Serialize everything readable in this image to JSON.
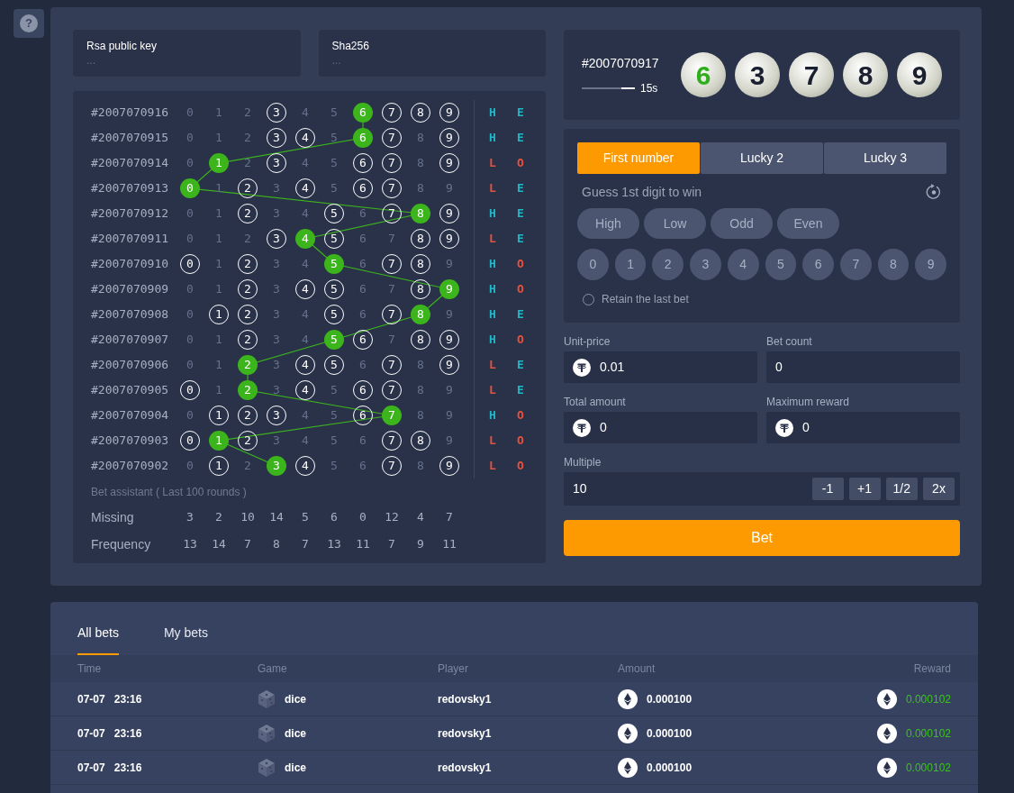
{
  "help_button": {
    "label": "?"
  },
  "keys": [
    {
      "label": "Rsa public key",
      "value": "..."
    },
    {
      "label": "Sha256",
      "value": "..."
    }
  ],
  "history": {
    "rows": [
      {
        "round": "#2007070916",
        "cells": [
          {
            "label": "0",
            "kind": "dim"
          },
          {
            "label": "1",
            "kind": "dim"
          },
          {
            "label": "2",
            "kind": "dim"
          },
          {
            "label": "3",
            "kind": "ring"
          },
          {
            "label": "4",
            "kind": "dim"
          },
          {
            "label": "5",
            "kind": "dim"
          },
          {
            "label": "6",
            "kind": "hit"
          },
          {
            "label": "7",
            "kind": "ring"
          },
          {
            "label": "8",
            "kind": "ring"
          },
          {
            "label": "9",
            "kind": "ring"
          }
        ],
        "size": {
          "label": "H",
          "color": "#1fb8c6"
        },
        "parity": {
          "label": "E",
          "color": "#1fb8c6"
        }
      },
      {
        "round": "#2007070915",
        "cells": [
          {
            "label": "0",
            "kind": "dim"
          },
          {
            "label": "1",
            "kind": "dim"
          },
          {
            "label": "2",
            "kind": "dim"
          },
          {
            "label": "3",
            "kind": "ring"
          },
          {
            "label": "4",
            "kind": "ring"
          },
          {
            "label": "5",
            "kind": "dim"
          },
          {
            "label": "6",
            "kind": "hit"
          },
          {
            "label": "7",
            "kind": "ring"
          },
          {
            "label": "8",
            "kind": "dim"
          },
          {
            "label": "9",
            "kind": "ring"
          }
        ],
        "size": {
          "label": "H",
          "color": "#1fb8c6"
        },
        "parity": {
          "label": "E",
          "color": "#1fb8c6"
        }
      },
      {
        "round": "#2007070914",
        "cells": [
          {
            "label": "0",
            "kind": "dim"
          },
          {
            "label": "1",
            "kind": "hit"
          },
          {
            "label": "2",
            "kind": "dim"
          },
          {
            "label": "3",
            "kind": "ring"
          },
          {
            "label": "4",
            "kind": "dim"
          },
          {
            "label": "5",
            "kind": "dim"
          },
          {
            "label": "6",
            "kind": "ring"
          },
          {
            "label": "7",
            "kind": "ring"
          },
          {
            "label": "8",
            "kind": "dim"
          },
          {
            "label": "9",
            "kind": "ring"
          }
        ],
        "size": {
          "label": "L",
          "color": "#e5523c"
        },
        "parity": {
          "label": "O",
          "color": "#e5523c"
        }
      },
      {
        "round": "#2007070913",
        "cells": [
          {
            "label": "0",
            "kind": "hit"
          },
          {
            "label": "1",
            "kind": "dim"
          },
          {
            "label": "2",
            "kind": "ring"
          },
          {
            "label": "3",
            "kind": "dim"
          },
          {
            "label": "4",
            "kind": "ring"
          },
          {
            "label": "5",
            "kind": "dim"
          },
          {
            "label": "6",
            "kind": "ring"
          },
          {
            "label": "7",
            "kind": "ring"
          },
          {
            "label": "8",
            "kind": "dim"
          },
          {
            "label": "9",
            "kind": "dim"
          }
        ],
        "size": {
          "label": "L",
          "color": "#e5523c"
        },
        "parity": {
          "label": "E",
          "color": "#1fb8c6"
        }
      },
      {
        "round": "#2007070912",
        "cells": [
          {
            "label": "0",
            "kind": "dim"
          },
          {
            "label": "1",
            "kind": "dim"
          },
          {
            "label": "2",
            "kind": "ring"
          },
          {
            "label": "3",
            "kind": "dim"
          },
          {
            "label": "4",
            "kind": "dim"
          },
          {
            "label": "5",
            "kind": "ring"
          },
          {
            "label": "6",
            "kind": "dim"
          },
          {
            "label": "7",
            "kind": "ring"
          },
          {
            "label": "8",
            "kind": "hit"
          },
          {
            "label": "9",
            "kind": "ring"
          }
        ],
        "size": {
          "label": "H",
          "color": "#1fb8c6"
        },
        "parity": {
          "label": "E",
          "color": "#1fb8c6"
        }
      },
      {
        "round": "#2007070911",
        "cells": [
          {
            "label": "0",
            "kind": "dim"
          },
          {
            "label": "1",
            "kind": "dim"
          },
          {
            "label": "2",
            "kind": "dim"
          },
          {
            "label": "3",
            "kind": "ring"
          },
          {
            "label": "4",
            "kind": "hit"
          },
          {
            "label": "5",
            "kind": "ring"
          },
          {
            "label": "6",
            "kind": "dim"
          },
          {
            "label": "7",
            "kind": "dim"
          },
          {
            "label": "8",
            "kind": "ring"
          },
          {
            "label": "9",
            "kind": "ring"
          }
        ],
        "size": {
          "label": "L",
          "color": "#e5523c"
        },
        "parity": {
          "label": "E",
          "color": "#1fb8c6"
        }
      },
      {
        "round": "#2007070910",
        "cells": [
          {
            "label": "0",
            "kind": "ring"
          },
          {
            "label": "1",
            "kind": "dim"
          },
          {
            "label": "2",
            "kind": "ring"
          },
          {
            "label": "3",
            "kind": "dim"
          },
          {
            "label": "4",
            "kind": "dim"
          },
          {
            "label": "5",
            "kind": "hit"
          },
          {
            "label": "6",
            "kind": "dim"
          },
          {
            "label": "7",
            "kind": "ring"
          },
          {
            "label": "8",
            "kind": "ring"
          },
          {
            "label": "9",
            "kind": "dim"
          }
        ],
        "size": {
          "label": "H",
          "color": "#1fb8c6"
        },
        "parity": {
          "label": "O",
          "color": "#e5523c"
        }
      },
      {
        "round": "#2007070909",
        "cells": [
          {
            "label": "0",
            "kind": "dim"
          },
          {
            "label": "1",
            "kind": "dim"
          },
          {
            "label": "2",
            "kind": "ring"
          },
          {
            "label": "3",
            "kind": "dim"
          },
          {
            "label": "4",
            "kind": "ring"
          },
          {
            "label": "5",
            "kind": "ring"
          },
          {
            "label": "6",
            "kind": "dim"
          },
          {
            "label": "7",
            "kind": "dim"
          },
          {
            "label": "8",
            "kind": "ring"
          },
          {
            "label": "9",
            "kind": "hit"
          }
        ],
        "size": {
          "label": "H",
          "color": "#1fb8c6"
        },
        "parity": {
          "label": "O",
          "color": "#e5523c"
        }
      },
      {
        "round": "#2007070908",
        "cells": [
          {
            "label": "0",
            "kind": "dim"
          },
          {
            "label": "1",
            "kind": "ring"
          },
          {
            "label": "2",
            "kind": "ring"
          },
          {
            "label": "3",
            "kind": "dim"
          },
          {
            "label": "4",
            "kind": "dim"
          },
          {
            "label": "5",
            "kind": "ring"
          },
          {
            "label": "6",
            "kind": "dim"
          },
          {
            "label": "7",
            "kind": "ring"
          },
          {
            "label": "8",
            "kind": "hit"
          },
          {
            "label": "9",
            "kind": "dim"
          }
        ],
        "size": {
          "label": "H",
          "color": "#1fb8c6"
        },
        "parity": {
          "label": "E",
          "color": "#1fb8c6"
        }
      },
      {
        "round": "#2007070907",
        "cells": [
          {
            "label": "0",
            "kind": "dim"
          },
          {
            "label": "1",
            "kind": "dim"
          },
          {
            "label": "2",
            "kind": "ring"
          },
          {
            "label": "3",
            "kind": "dim"
          },
          {
            "label": "4",
            "kind": "dim"
          },
          {
            "label": "5",
            "kind": "hit"
          },
          {
            "label": "6",
            "kind": "ring"
          },
          {
            "label": "7",
            "kind": "dim"
          },
          {
            "label": "8",
            "kind": "ring"
          },
          {
            "label": "9",
            "kind": "ring"
          }
        ],
        "size": {
          "label": "H",
          "color": "#1fb8c6"
        },
        "parity": {
          "label": "O",
          "color": "#e5523c"
        }
      },
      {
        "round": "#2007070906",
        "cells": [
          {
            "label": "0",
            "kind": "dim"
          },
          {
            "label": "1",
            "kind": "dim"
          },
          {
            "label": "2",
            "kind": "hit"
          },
          {
            "label": "3",
            "kind": "dim"
          },
          {
            "label": "4",
            "kind": "ring"
          },
          {
            "label": "5",
            "kind": "ring"
          },
          {
            "label": "6",
            "kind": "dim"
          },
          {
            "label": "7",
            "kind": "ring"
          },
          {
            "label": "8",
            "kind": "dim"
          },
          {
            "label": "9",
            "kind": "ring"
          }
        ],
        "size": {
          "label": "L",
          "color": "#e5523c"
        },
        "parity": {
          "label": "E",
          "color": "#1fb8c6"
        }
      },
      {
        "round": "#2007070905",
        "cells": [
          {
            "label": "0",
            "kind": "ring"
          },
          {
            "label": "1",
            "kind": "dim"
          },
          {
            "label": "2",
            "kind": "hit"
          },
          {
            "label": "3",
            "kind": "dim"
          },
          {
            "label": "4",
            "kind": "ring"
          },
          {
            "label": "5",
            "kind": "dim"
          },
          {
            "label": "6",
            "kind": "ring"
          },
          {
            "label": "7",
            "kind": "ring"
          },
          {
            "label": "8",
            "kind": "dim"
          },
          {
            "label": "9",
            "kind": "dim"
          }
        ],
        "size": {
          "label": "L",
          "color": "#e5523c"
        },
        "parity": {
          "label": "E",
          "color": "#1fb8c6"
        }
      },
      {
        "round": "#2007070904",
        "cells": [
          {
            "label": "0",
            "kind": "dim"
          },
          {
            "label": "1",
            "kind": "ring"
          },
          {
            "label": "2",
            "kind": "ring"
          },
          {
            "label": "3",
            "kind": "ring"
          },
          {
            "label": "4",
            "kind": "dim"
          },
          {
            "label": "5",
            "kind": "dim"
          },
          {
            "label": "6",
            "kind": "ring"
          },
          {
            "label": "7",
            "kind": "hit"
          },
          {
            "label": "8",
            "kind": "dim"
          },
          {
            "label": "9",
            "kind": "dim"
          }
        ],
        "size": {
          "label": "H",
          "color": "#1fb8c6"
        },
        "parity": {
          "label": "O",
          "color": "#e5523c"
        }
      },
      {
        "round": "#2007070903",
        "cells": [
          {
            "label": "0",
            "kind": "ring"
          },
          {
            "label": "1",
            "kind": "hit"
          },
          {
            "label": "2",
            "kind": "ring"
          },
          {
            "label": "3",
            "kind": "dim"
          },
          {
            "label": "4",
            "kind": "dim"
          },
          {
            "label": "5",
            "kind": "dim"
          },
          {
            "label": "6",
            "kind": "dim"
          },
          {
            "label": "7",
            "kind": "ring"
          },
          {
            "label": "8",
            "kind": "ring"
          },
          {
            "label": "9",
            "kind": "dim"
          }
        ],
        "size": {
          "label": "L",
          "color": "#e5523c"
        },
        "parity": {
          "label": "O",
          "color": "#e5523c"
        }
      },
      {
        "round": "#2007070902",
        "cells": [
          {
            "label": "0",
            "kind": "dim"
          },
          {
            "label": "1",
            "kind": "ring"
          },
          {
            "label": "2",
            "kind": "dim"
          },
          {
            "label": "3",
            "kind": "hit"
          },
          {
            "label": "4",
            "kind": "ring"
          },
          {
            "label": "5",
            "kind": "dim"
          },
          {
            "label": "6",
            "kind": "dim"
          },
          {
            "label": "7",
            "kind": "ring"
          },
          {
            "label": "8",
            "kind": "dim"
          },
          {
            "label": "9",
            "kind": "ring"
          }
        ],
        "size": {
          "label": "L",
          "color": "#e5523c"
        },
        "parity": {
          "label": "O",
          "color": "#e5523c"
        }
      }
    ],
    "assistant_title": "Bet assistant ( Last 100 rounds )",
    "stats": [
      {
        "label": "Missing",
        "values": [
          "3",
          "2",
          "10",
          "14",
          "5",
          "6",
          "0",
          "12",
          "4",
          "7"
        ]
      },
      {
        "label": "Frequency",
        "values": [
          "13",
          "14",
          "7",
          "8",
          "7",
          "13",
          "11",
          "7",
          "9",
          "11"
        ]
      }
    ]
  },
  "draw": {
    "round": "#2007070917",
    "countdown": "15s",
    "level": 0.25,
    "balls": [
      {
        "label": "6",
        "highlighted": true
      },
      {
        "label": "3",
        "highlighted": false
      },
      {
        "label": "7",
        "highlighted": false
      },
      {
        "label": "8",
        "highlighted": false
      },
      {
        "label": "9",
        "highlighted": false
      }
    ]
  },
  "modes": [
    {
      "label": "First number",
      "selected": true
    },
    {
      "label": "Lucky 2",
      "selected": false
    },
    {
      "label": "Lucky 3",
      "selected": false
    }
  ],
  "hint": "Guess 1st digit to win",
  "options": [
    "High",
    "Low",
    "Odd",
    "Even"
  ],
  "digits": [
    "0",
    "1",
    "2",
    "3",
    "4",
    "5",
    "6",
    "7",
    "8",
    "9"
  ],
  "retain": {
    "label": "Retain the last bet",
    "checked": false
  },
  "fields": [
    {
      "label": "Unit-price",
      "value": "0.01",
      "coin": true
    },
    {
      "label": "Bet count",
      "value": "0",
      "coin": false
    },
    {
      "label": "Total amount",
      "value": "0",
      "coin": true
    },
    {
      "label": "Maximum reward",
      "value": "0",
      "coin": true
    }
  ],
  "multiple": {
    "label": "Multiple",
    "value": "10",
    "buttons": [
      "-1",
      "+1",
      "1/2",
      "2x"
    ]
  },
  "bet_button": "Bet",
  "bets": {
    "tabs": [
      {
        "label": "All bets",
        "selected": true
      },
      {
        "label": "My bets",
        "selected": false
      }
    ],
    "columns": [
      "Time",
      "Game",
      "Player",
      "Amount",
      "Reward"
    ],
    "rows": [
      {
        "date": "07-07",
        "time": "23:16",
        "game": "dice",
        "player": "redovsky1",
        "amount": "0.000100",
        "reward": "0.000102"
      },
      {
        "date": "07-07",
        "time": "23:16",
        "game": "dice",
        "player": "redovsky1",
        "amount": "0.000100",
        "reward": "0.000102"
      },
      {
        "date": "07-07",
        "time": "23:16",
        "game": "dice",
        "player": "redovsky1",
        "amount": "0.000100",
        "reward": "0.000102"
      }
    ]
  }
}
